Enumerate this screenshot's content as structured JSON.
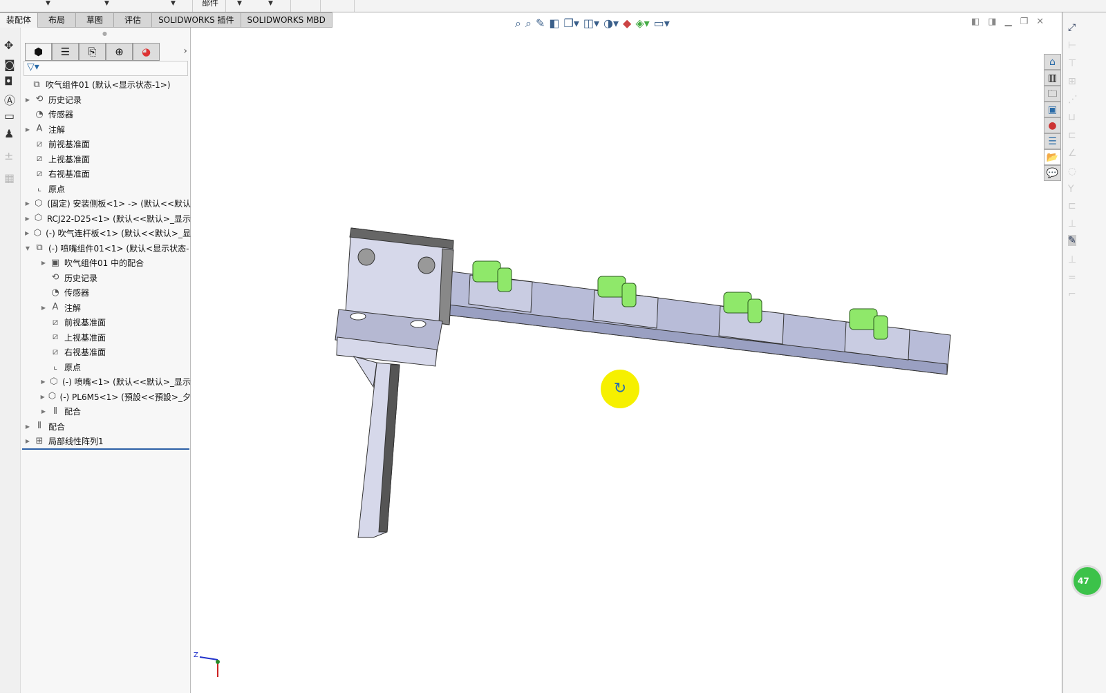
{
  "topbar": {
    "label": "部件"
  },
  "tabs": [
    "装配体",
    "布局",
    "草图",
    "评估",
    "SOLIDWORKS 插件",
    "SOLIDWORKS MBD"
  ],
  "tree": [
    {
      "label": "吹气组件01  (默认<显示状态-1>)",
      "level": 0,
      "arrow": "",
      "icon": "assembly-icon"
    },
    {
      "label": "历史记录",
      "level": 1,
      "arrow": "▶",
      "icon": "history-icon"
    },
    {
      "label": "传感器",
      "level": 1,
      "arrow": "",
      "icon": "sensor-icon"
    },
    {
      "label": "注解",
      "level": 1,
      "arrow": "▶",
      "icon": "annotation-icon"
    },
    {
      "label": "前视基准面",
      "level": 1,
      "arrow": "",
      "icon": "plane-icon"
    },
    {
      "label": "上视基准面",
      "level": 1,
      "arrow": "",
      "icon": "plane-icon"
    },
    {
      "label": "右视基准面",
      "level": 1,
      "arrow": "",
      "icon": "plane-icon"
    },
    {
      "label": "原点",
      "level": 1,
      "arrow": "",
      "icon": "origin-icon"
    },
    {
      "label": "(固定) 安装侧板<1> -> (默认<<默认",
      "level": 1,
      "arrow": "▶",
      "icon": "part-icon"
    },
    {
      "label": "RCJ22-D25<1> (默认<<默认>_显示",
      "level": 1,
      "arrow": "▶",
      "icon": "part-icon"
    },
    {
      "label": "(-) 吹气连杆板<1> (默认<<默认>_显",
      "level": 1,
      "arrow": "▶",
      "icon": "part-icon"
    },
    {
      "label": "(-) 喷嘴组件01<1> (默认<显示状态-",
      "level": 1,
      "arrow": "▼",
      "icon": "assembly-icon"
    },
    {
      "label": "吹气组件01 中的配合",
      "level": 2,
      "arrow": "▶",
      "icon": "mates-folder-icon"
    },
    {
      "label": "历史记录",
      "level": 2,
      "arrow": "",
      "icon": "history-icon"
    },
    {
      "label": "传感器",
      "level": 2,
      "arrow": "",
      "icon": "sensor-icon"
    },
    {
      "label": "注解",
      "level": 2,
      "arrow": "▶",
      "icon": "annotation-icon"
    },
    {
      "label": "前视基准面",
      "level": 2,
      "arrow": "",
      "icon": "plane-icon"
    },
    {
      "label": "上视基准面",
      "level": 2,
      "arrow": "",
      "icon": "plane-icon"
    },
    {
      "label": "右视基准面",
      "level": 2,
      "arrow": "",
      "icon": "plane-icon"
    },
    {
      "label": "原点",
      "level": 2,
      "arrow": "",
      "icon": "origin-icon"
    },
    {
      "label": "(-) 喷嘴<1> (默认<<默认>_显示",
      "level": 2,
      "arrow": "▶",
      "icon": "part-icon"
    },
    {
      "label": "(-) PL6M5<1> (預設<<預設>_夕",
      "level": 2,
      "arrow": "▶",
      "icon": "part-icon"
    },
    {
      "label": "配合",
      "level": 2,
      "arrow": "▶",
      "icon": "mates-icon"
    },
    {
      "label": "配合",
      "level": 1,
      "arrow": "▶",
      "icon": "mates-icon"
    },
    {
      "label": "局部线性阵列1",
      "level": 1,
      "arrow": "▶",
      "icon": "linear-pattern-icon"
    }
  ],
  "triad": {
    "z": "Z"
  },
  "badge": "47",
  "colors": {
    "part": "#b8bcd8",
    "fitting": "#8fe86a",
    "tree_selection": "#2b5fa6",
    "rotate_cursor": "#f6f000"
  }
}
